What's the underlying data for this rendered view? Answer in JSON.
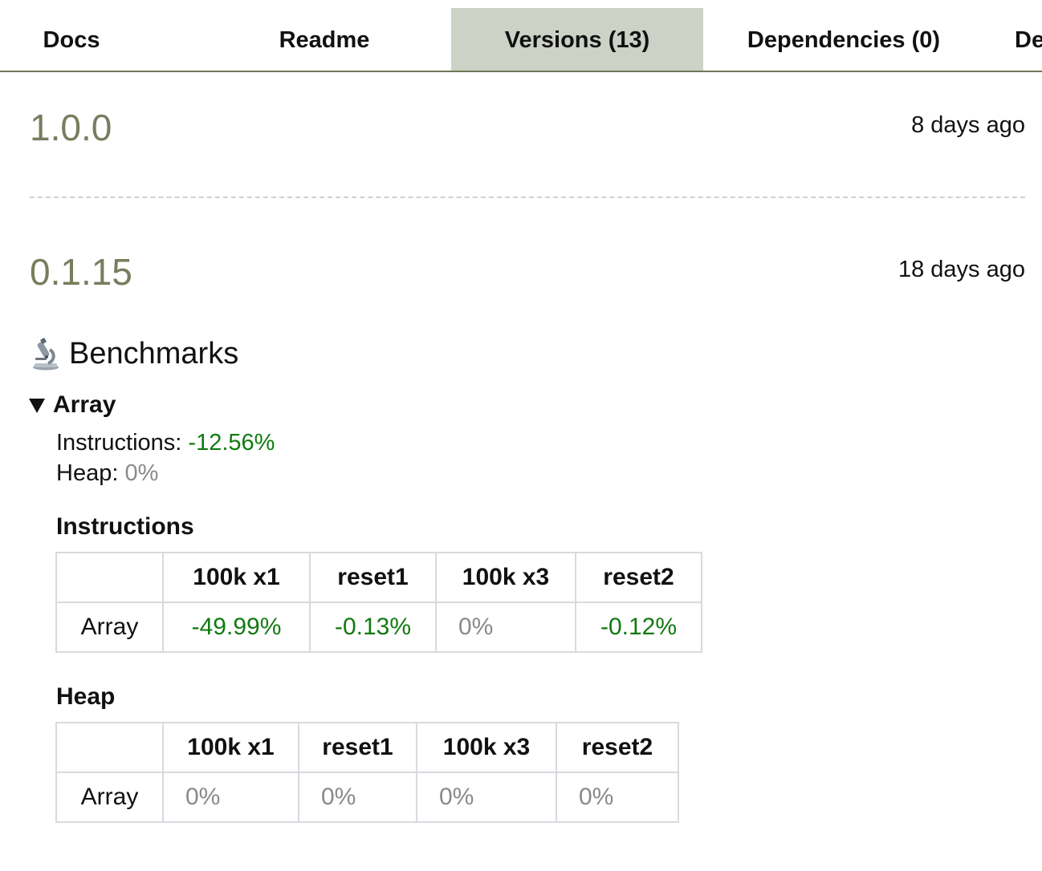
{
  "tabs": [
    {
      "label": "Docs",
      "active": false
    },
    {
      "label": "Readme",
      "active": false
    },
    {
      "label": "Versions (13)",
      "active": true
    },
    {
      "label": "Dependencies (0)",
      "active": false
    },
    {
      "label": "De",
      "active": false
    }
  ],
  "versions": [
    {
      "name": "1.0.0",
      "date": "8 days ago"
    },
    {
      "name": "0.1.15",
      "date": "18 days ago"
    }
  ],
  "benchmarks": {
    "icon": "microscope-icon",
    "title": "Benchmarks",
    "group": {
      "name": "Array",
      "expanded": true,
      "instructions_label": "Instructions:",
      "instructions_value": "-12.56%",
      "heap_label": "Heap:",
      "heap_value": "0%"
    },
    "instructions_table": {
      "title": "Instructions",
      "columns": [
        "",
        "100k x1",
        "reset1",
        "100k x3",
        "reset2"
      ],
      "row_label": "Array",
      "values": [
        "-49.99%",
        "-0.13%",
        "0%",
        "-0.12%"
      ]
    },
    "heap_table": {
      "title": "Heap",
      "columns": [
        "",
        "100k x1",
        "reset1",
        "100k x3",
        "reset2"
      ],
      "row_label": "Array",
      "values": [
        "0%",
        "0%",
        "0%",
        "0%"
      ]
    }
  },
  "colors": {
    "accent": "#767e5d",
    "tab_active_bg": "#cdd2c6",
    "improvement": "#117a11",
    "neutral": "#8a8a8a"
  }
}
